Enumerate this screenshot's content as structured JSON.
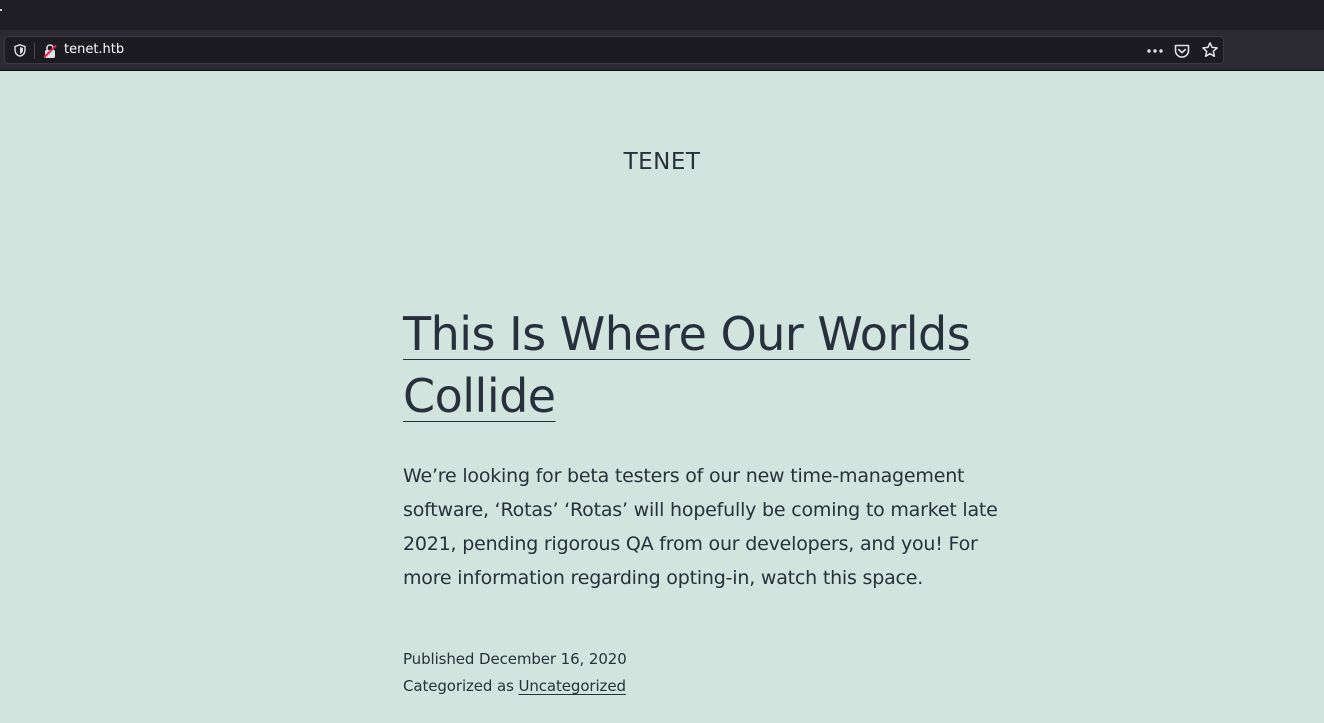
{
  "browser": {
    "url": "tenet.htb",
    "more_icon": "more-horizontal-icon",
    "pocket_icon": "pocket-icon",
    "bookmark_icon": "star-icon",
    "tracking_icon": "shield-icon",
    "security_icon": "insecure-lock-icon"
  },
  "site": {
    "title": "TENET"
  },
  "post": {
    "title": "This Is Where Our Worlds Collide",
    "body": "We’re looking for beta testers of our new time-management software, ‘Rotas’ ‘Rotas’ will hopefully be coming to market late 2021, pending rigorous QA from our developers, and you! For more information regarding opting-in, watch this space.",
    "published_label": "Published",
    "published_date": "December 16, 2020",
    "category_label": "Categorized as",
    "category": "Uncategorized"
  },
  "colors": {
    "page_background": "#d1e4dd",
    "text": "#28303d",
    "toolbar": "#2b2a33"
  }
}
